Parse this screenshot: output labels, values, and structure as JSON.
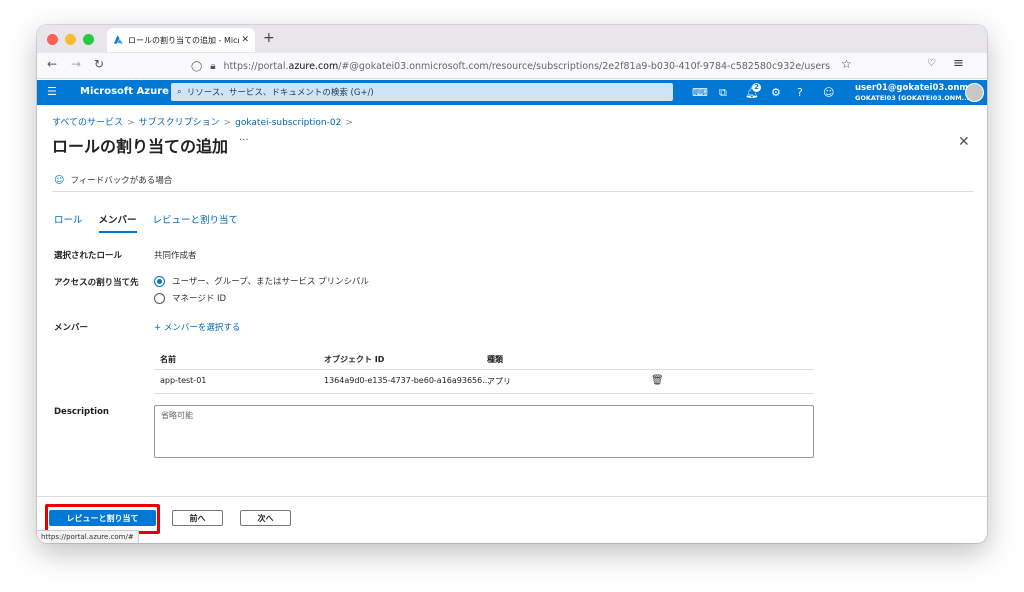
{
  "browser": {
    "tab_title": "ロールの割り当ての追加 - Micros",
    "new_tab": "+",
    "url_prefix": "https://portal.",
    "url_host": "azure.com",
    "url_rest": "/#@gokatei03.onmicrosoft.com/resource/subscriptions/2e2f81a9-b030-410f-9784-c582580c932e/users",
    "status_url": "https://portal.azure.com/#"
  },
  "header": {
    "brand": "Microsoft Azure",
    "search_placeholder": "リソース、サービス、ドキュメントの検索 (G+/)",
    "notification_count": "2",
    "user_email": "user01@gokatei03.onm...",
    "user_tenant": "GOKATEI03 (GOKATEI03.ONM..."
  },
  "breadcrumb": {
    "item1": "すべてのサービス",
    "item2": "サブスクリプション",
    "item3": "gokatei-subscription-02",
    "sep": ">"
  },
  "page": {
    "title": "ロールの割り当ての追加",
    "more": "···",
    "feedback": "フィードバックがある場合"
  },
  "tabs": {
    "role": "ロール",
    "members": "メンバー",
    "review": "レビューと割り当て"
  },
  "form": {
    "selected_role_label": "選択されたロール",
    "selected_role_value": "共同作成者",
    "access_label": "アクセスの割り当て先",
    "access_option1": "ユーザー、グループ、またはサービス プリンシパル",
    "access_option2": "マネージド ID",
    "members_label": "メンバー",
    "add_members_link": "+ メンバーを選択する",
    "description_label": "Description",
    "description_placeholder": "省略可能"
  },
  "table": {
    "headers": {
      "name": "名前",
      "object_id": "オブジェクト ID",
      "type": "種類"
    },
    "rows": [
      {
        "name": "app-test-01",
        "object_id": "1364a9d0-e135-4737-be60-a16a93656...",
        "type": "アプリ"
      }
    ]
  },
  "footer": {
    "review_button": "レビューと割り当て",
    "prev_button": "前へ",
    "next_button": "次へ"
  },
  "colors": {
    "azure_blue": "#0078d4",
    "highlight_red": "#e60000"
  }
}
